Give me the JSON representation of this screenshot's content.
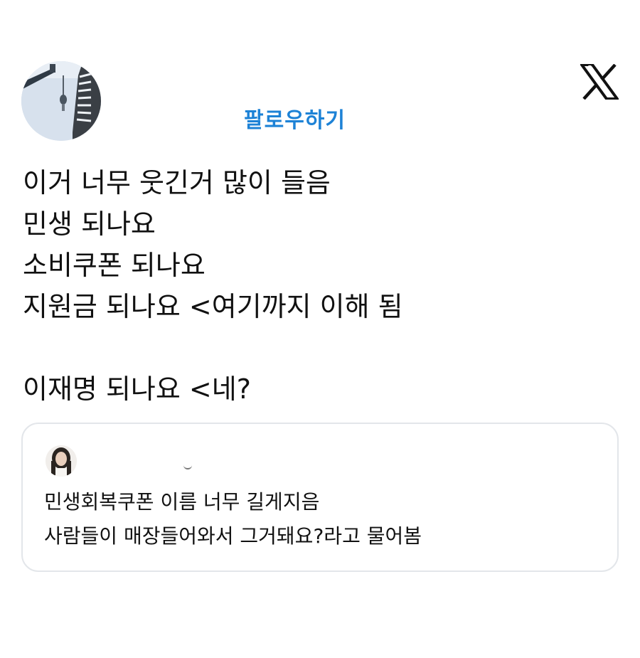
{
  "header": {
    "avatar_icon": "profile-photo-icon",
    "follow_label": "팔로우하기",
    "logo_icon": "x-logo-icon"
  },
  "tweet": {
    "lines": [
      "이거 너무 웃긴거 많이 들음",
      "민생 되나요",
      "소비쿠폰 되나요",
      "지원금 되나요 <여기까지 이해 됨",
      "이재명 되나요 <네?"
    ]
  },
  "quote": {
    "avatar_icon": "quoted-user-avatar-icon",
    "lines": [
      "민생회복쿠폰 이름 너무 길게지음",
      "사람들이 매장들어와서 그거돼요?라고 물어봄"
    ]
  },
  "colors": {
    "follow": "#1d82d6",
    "text": "#111111",
    "card_border": "#e3e6ea",
    "background": "#ffffff"
  }
}
